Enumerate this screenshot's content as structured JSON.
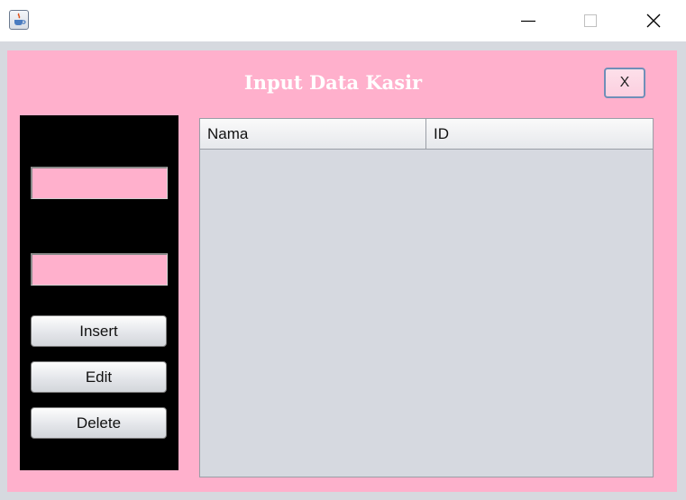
{
  "window": {
    "app_icon": "java-cup-icon",
    "controls": {
      "minimize_icon": "minimize-icon",
      "maximize_icon": "maximize-icon",
      "close_icon": "close-icon"
    }
  },
  "form": {
    "title": "Input Data Kasir",
    "close_label": "X",
    "background_color": "#ffb0cc",
    "sidebar": {
      "background_color": "#000000",
      "fields": [
        {
          "value": ""
        },
        {
          "value": ""
        }
      ],
      "buttons": {
        "insert": "Insert",
        "edit": "Edit",
        "delete": "Delete"
      }
    },
    "table": {
      "columns": [
        "Nama",
        "ID"
      ],
      "rows": []
    }
  }
}
